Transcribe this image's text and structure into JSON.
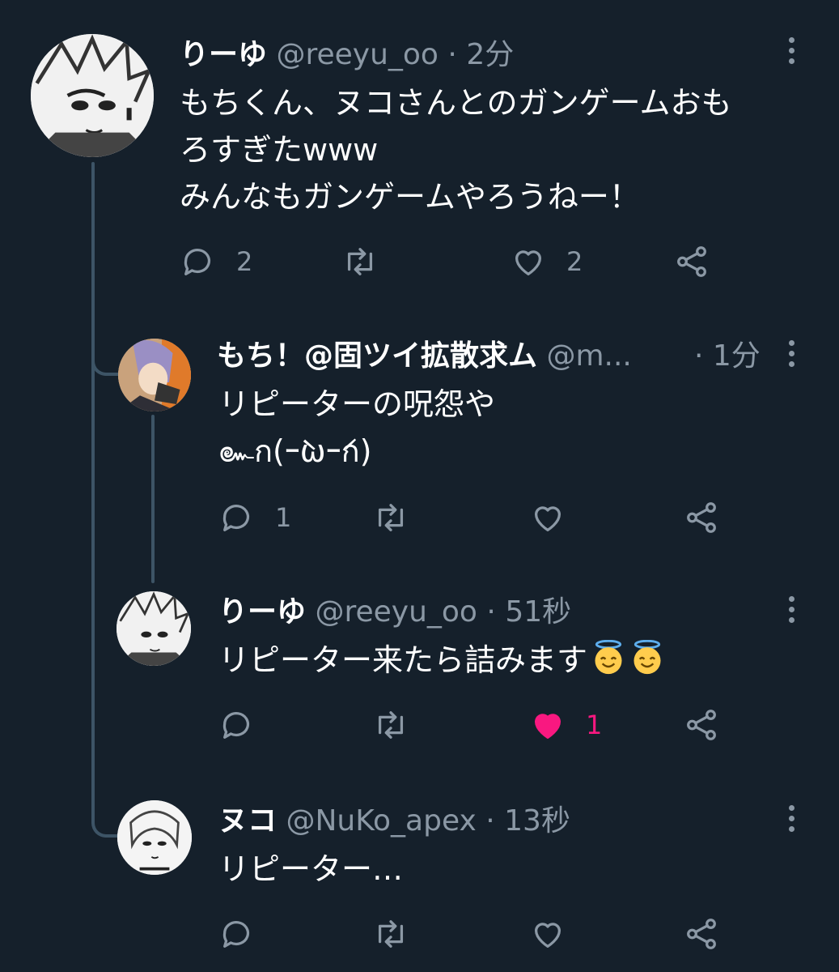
{
  "tweets": [
    {
      "name": "りーゆ",
      "handle": "@reeyu_oo",
      "time": "2分",
      "lines": [
        "もちくん、ヌコさんとのガンゲームおも",
        "ろすぎたwww",
        "みんなもガンゲームやろうねー！"
      ],
      "reply_count": "2",
      "retweet_count": "",
      "like_count": "2",
      "liked": false
    },
    {
      "name": "もち！@固ツイ拡散求ム",
      "handle": "@m...",
      "time": "1分",
      "lines": [
        "リピーターの呪怨や",
        "๛ก(ｰ̀ωｰ́ก)"
      ],
      "reply_count": "1",
      "retweet_count": "",
      "like_count": "",
      "liked": false
    },
    {
      "name": "りーゆ",
      "handle": "@reeyu_oo",
      "time": "51秒",
      "lines": [
        "リピーター来たら詰みます"
      ],
      "emojis": [
        "smiling-face-with-halo",
        "smiling-face-with-halo"
      ],
      "reply_count": "",
      "retweet_count": "",
      "like_count": "1",
      "liked": true
    },
    {
      "name": "ヌコ",
      "handle": "@NuKo_apex",
      "time": "13秒",
      "lines": [
        "リピーター…"
      ],
      "reply_count": "",
      "retweet_count": "",
      "like_count": "",
      "liked": false
    }
  ],
  "separator": "·",
  "colors": {
    "background": "#15202b",
    "muted": "#8b98a5",
    "thread_line": "#3d5466",
    "like_active": "#f91880"
  }
}
